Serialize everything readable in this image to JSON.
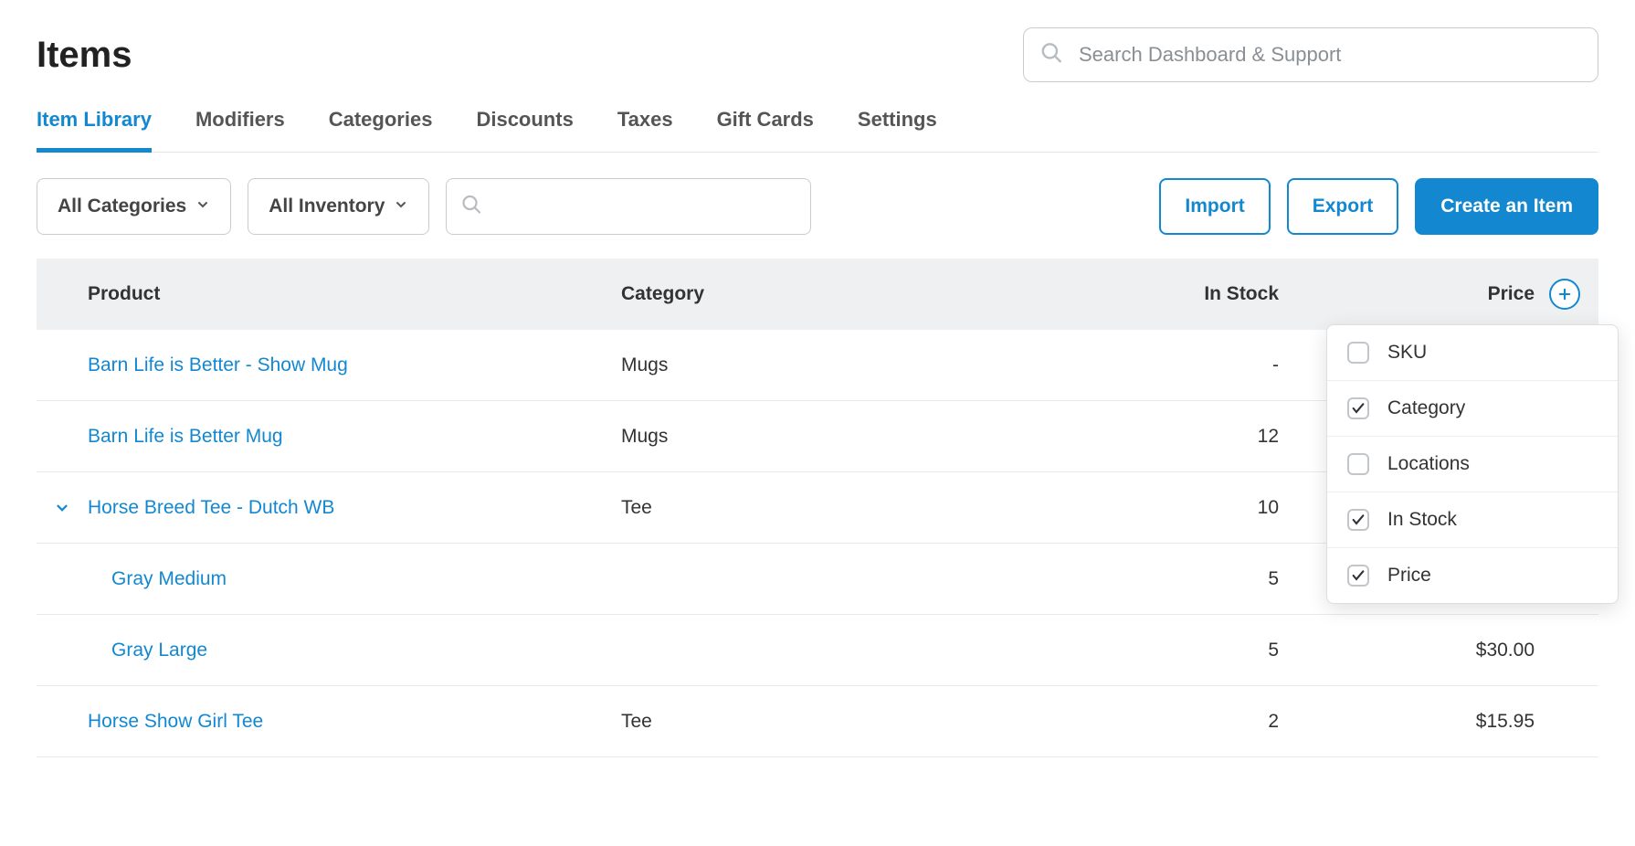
{
  "page_title": "Items",
  "search": {
    "placeholder": "Search Dashboard & Support"
  },
  "tabs": [
    {
      "label": "Item Library",
      "active": true
    },
    {
      "label": "Modifiers",
      "active": false
    },
    {
      "label": "Categories",
      "active": false
    },
    {
      "label": "Discounts",
      "active": false
    },
    {
      "label": "Taxes",
      "active": false
    },
    {
      "label": "Gift Cards",
      "active": false
    },
    {
      "label": "Settings",
      "active": false
    }
  ],
  "filters": {
    "category_label": "All Categories",
    "inventory_label": "All Inventory"
  },
  "actions": {
    "import": "Import",
    "export": "Export",
    "create": "Create an Item"
  },
  "columns": {
    "product": "Product",
    "category": "Category",
    "in_stock": "In Stock",
    "price": "Price"
  },
  "column_menu": [
    {
      "label": "SKU",
      "checked": false
    },
    {
      "label": "Category",
      "checked": true
    },
    {
      "label": "Locations",
      "checked": false
    },
    {
      "label": "In Stock",
      "checked": true
    },
    {
      "label": "Price",
      "checked": true
    }
  ],
  "rows": [
    {
      "name": "Barn Life is Better - Show Mug",
      "category": "Mugs",
      "stock": "-",
      "price": "",
      "expandable": false,
      "indent": 0
    },
    {
      "name": "Barn Life is Better Mug",
      "category": "Mugs",
      "stock": "12",
      "price": "",
      "expandable": false,
      "indent": 0
    },
    {
      "name": "Horse Breed Tee - Dutch WB",
      "category": "Tee",
      "stock": "10",
      "price": "",
      "expandable": true,
      "indent": 0
    },
    {
      "name": "Gray Medium",
      "category": "",
      "stock": "5",
      "price": "",
      "expandable": false,
      "indent": 1
    },
    {
      "name": "Gray Large",
      "category": "",
      "stock": "5",
      "price": "$30.00",
      "expandable": false,
      "indent": 1
    },
    {
      "name": "Horse Show Girl Tee",
      "category": "Tee",
      "stock": "2",
      "price": "$15.95",
      "expandable": false,
      "indent": 0
    }
  ]
}
